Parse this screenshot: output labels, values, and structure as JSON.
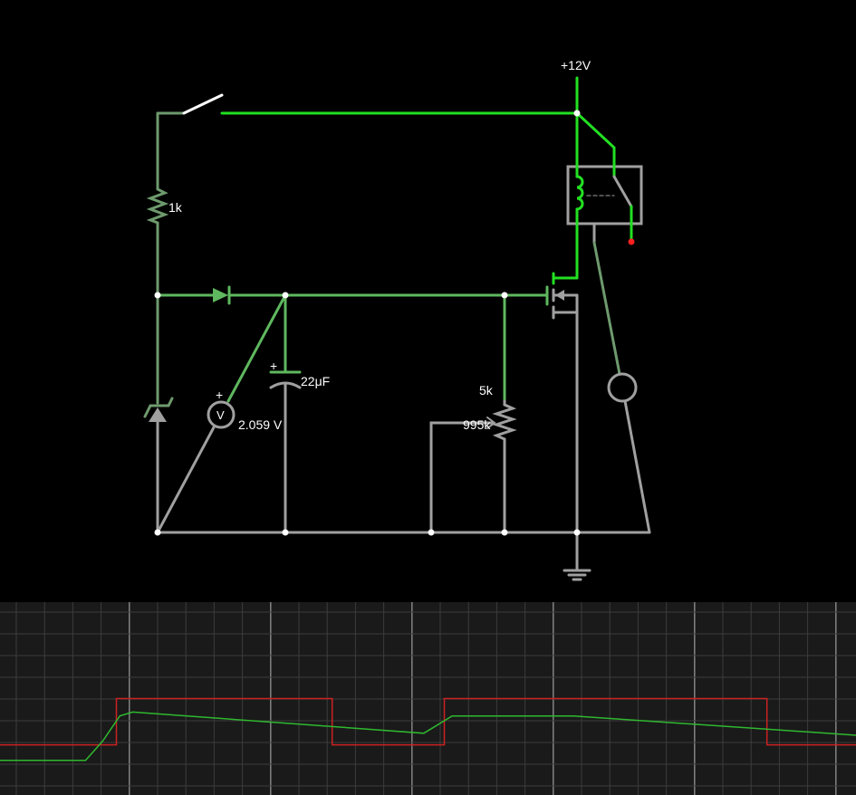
{
  "circuit": {
    "supply_label": "+12V",
    "resistor_label": "1k",
    "capacitor_label": "22μF",
    "pot_label_top": "5k",
    "pot_label_value": "995k",
    "voltmeter_symbol": "V",
    "voltmeter_plus": "+",
    "capacitor_plus": "+",
    "voltmeter_reading": "2.059 V"
  },
  "colors": {
    "wire_active": "#22e022",
    "wire_mid": "#5fb85f",
    "wire_dim": "#6e9a6e",
    "wire_idle": "#a0a0a0",
    "background": "#000000",
    "scope_bg": "#1a1a1a",
    "trace_voltage": "#2fb82f",
    "trace_switch": "#cc2222",
    "relay_dot": "#ff2020"
  },
  "scope": {
    "traces": [
      {
        "name": "",
        "color": "#cc2222",
        "points": [
          [
            0,
            0.74
          ],
          [
            0.136,
            0.74
          ],
          [
            0.136,
            0.5
          ],
          [
            0.388,
            0.5
          ],
          [
            0.388,
            0.74
          ],
          [
            0.519,
            0.74
          ],
          [
            0.519,
            0.5
          ],
          [
            0.896,
            0.5
          ],
          [
            0.896,
            0.74
          ],
          [
            1,
            0.74
          ]
        ]
      },
      {
        "name": "",
        "color": "#2fb82f",
        "points": [
          [
            0,
            0.82
          ],
          [
            0.1,
            0.82
          ],
          [
            0.12,
            0.72
          ],
          [
            0.14,
            0.59
          ],
          [
            0.155,
            0.57
          ],
          [
            0.495,
            0.68
          ],
          [
            0.51,
            0.64
          ],
          [
            0.528,
            0.59
          ],
          [
            0.67,
            0.59
          ],
          [
            1,
            0.69
          ]
        ]
      }
    ]
  }
}
